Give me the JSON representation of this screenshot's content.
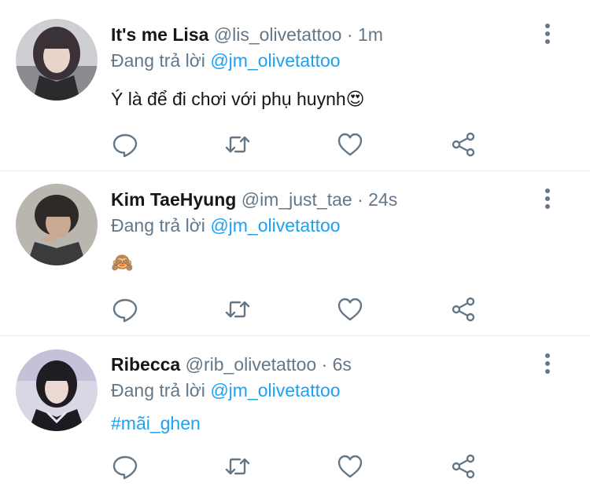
{
  "reply_prefix": "Đang trả lời",
  "tweets": [
    {
      "name": "It's me Lisa",
      "handle": "@lis_olivetattoo",
      "separator": "·",
      "time": "1m",
      "reply_to": "@jm_olivetattoo",
      "text": "Ý là để đi chơi với phụ huynh😍"
    },
    {
      "name": "Kim TaeHyung",
      "handle": "@im_just_tae",
      "separator": "·",
      "time": "24s",
      "reply_to": "@jm_olivetattoo",
      "text": "🙈"
    },
    {
      "name": "Ribecca",
      "handle": "@rib_olivetattoo",
      "separator": "·",
      "time": "6s",
      "reply_to": "@jm_olivetattoo",
      "text": "#mãi_ghen"
    }
  ],
  "colors": {
    "mention": "#1da1f2",
    "muted": "#657786",
    "text": "#14171a",
    "divider": "#e6ecf0"
  },
  "icons": [
    "reply-icon",
    "retweet-icon",
    "like-icon",
    "share-icon",
    "more-options-icon"
  ]
}
